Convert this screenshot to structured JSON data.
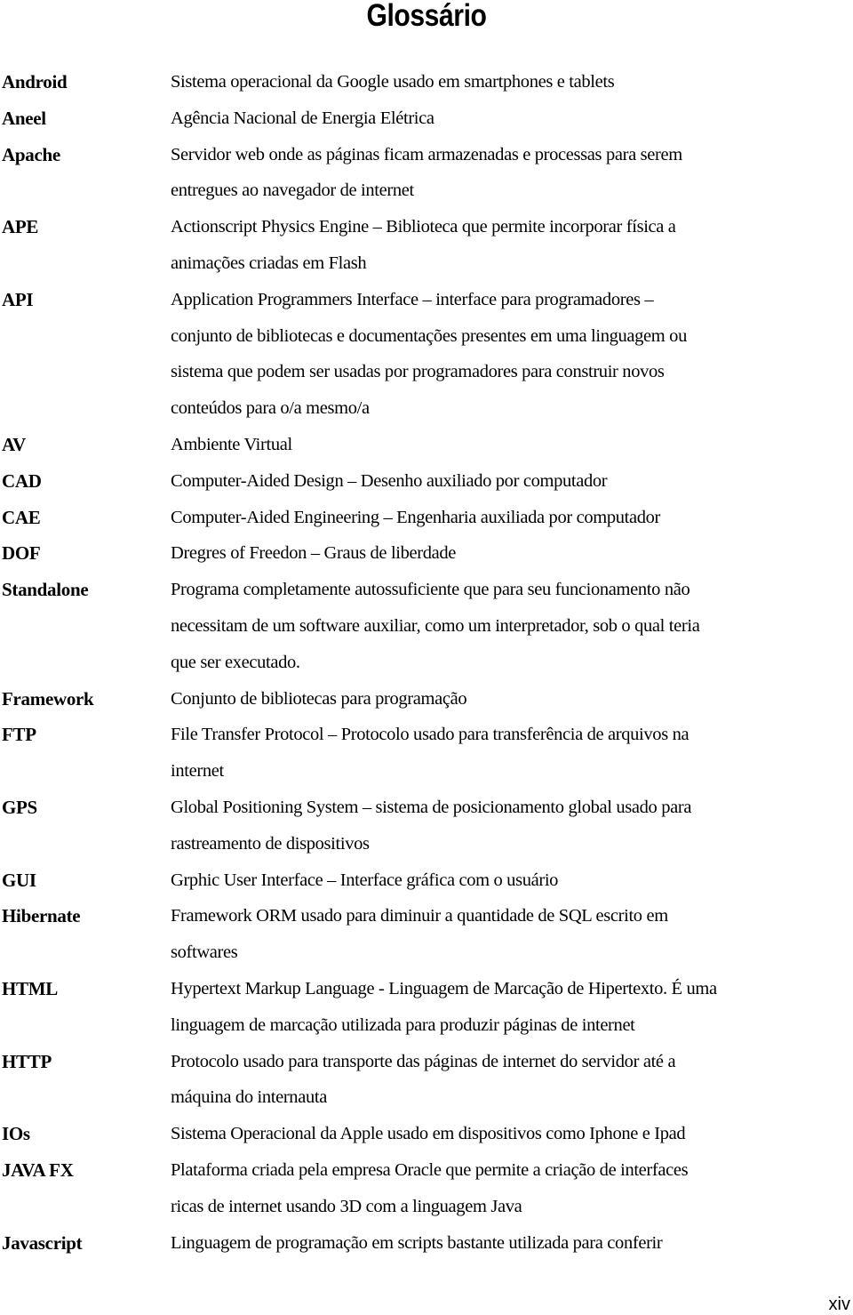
{
  "document": {
    "title": "Glossário",
    "page_number": "xiv"
  },
  "glossary": {
    "entries": [
      {
        "term": "Android",
        "definition_lines": [
          "Sistema operacional da Google usado em smartphones e tablets"
        ]
      },
      {
        "term": "Aneel",
        "definition_lines": [
          "Agência Nacional de Energia Elétrica"
        ]
      },
      {
        "term": "Apache",
        "definition_lines": [
          "Servidor web onde as páginas ficam armazenadas e processas para serem",
          "entregues ao navegador de internet"
        ]
      },
      {
        "term": "APE",
        "definition_lines": [
          "Actionscript Physics Engine – Biblioteca que permite incorporar física a",
          "animações criadas em Flash"
        ]
      },
      {
        "term": "API",
        "definition_lines": [
          "Application Programmers Interface – interface para programadores –",
          "conjunto de bibliotecas e documentações presentes em uma linguagem ou",
          "sistema que podem ser usadas por programadores para construir novos",
          "conteúdos para o/a mesmo/a"
        ]
      },
      {
        "term": "AV",
        "definition_lines": [
          "Ambiente Virtual"
        ]
      },
      {
        "term": "CAD",
        "definition_lines": [
          "Computer-Aided Design – Desenho auxiliado por computador"
        ]
      },
      {
        "term": "CAE",
        "definition_lines": [
          "Computer-Aided Engineering – Engenharia auxiliada por computador"
        ]
      },
      {
        "term": "DOF",
        "definition_lines": [
          "Dregres of Freedon – Graus de liberdade"
        ]
      },
      {
        "term": "Standalone",
        "definition_lines": [
          "Programa completamente autossuficiente que para seu funcionamento não",
          "necessitam de um software auxiliar, como um interpretador, sob o qual teria",
          "que ser executado."
        ]
      },
      {
        "term": "Framework",
        "definition_lines": [
          "Conjunto de bibliotecas para programação"
        ]
      },
      {
        "term": "FTP",
        "definition_lines": [
          "File Transfer Protocol – Protocolo usado para transferência de arquivos na",
          "internet"
        ]
      },
      {
        "term": "GPS",
        "definition_lines": [
          "Global Positioning System – sistema de posicionamento global usado para",
          "rastreamento de dispositivos"
        ]
      },
      {
        "term": "GUI",
        "definition_lines": [
          "Grphic User Interface – Interface gráfica com o usuário"
        ]
      },
      {
        "term": "Hibernate",
        "definition_lines": [
          "Framework ORM usado para diminuir a quantidade de SQL escrito em",
          "softwares"
        ]
      },
      {
        "term": "HTML",
        "definition_lines": [
          "Hypertext Markup Language - Linguagem de Marcação de Hipertexto. É uma",
          "linguagem de marcação utilizada para produzir páginas de internet"
        ]
      },
      {
        "term": "HTTP",
        "definition_lines": [
          "Protocolo usado para transporte das páginas de internet do servidor até a",
          "máquina do internauta"
        ]
      },
      {
        "term": "IOs",
        "definition_lines": [
          "Sistema Operacional da Apple usado em dispositivos como Iphone e Ipad"
        ]
      },
      {
        "term": "JAVA FX",
        "definition_lines": [
          "Plataforma criada pela empresa Oracle que permite a criação de interfaces",
          "ricas de internet usando 3D com a linguagem Java"
        ]
      },
      {
        "term": "Javascript",
        "definition_lines": [
          "Linguagem de programação em scripts bastante utilizada para conferir"
        ]
      }
    ]
  }
}
